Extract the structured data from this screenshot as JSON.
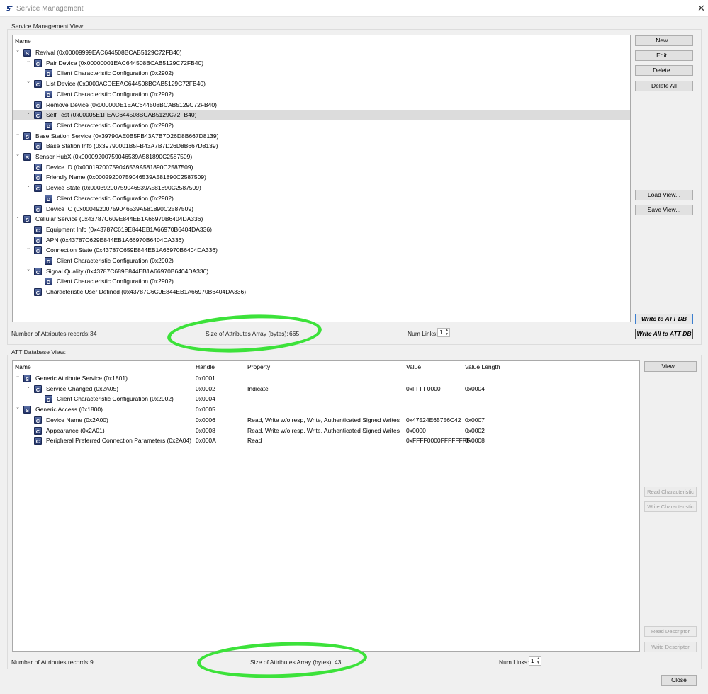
{
  "window": {
    "title": "Service Management"
  },
  "smv": {
    "label": "Service Management View:",
    "header": "Name",
    "items": [
      {
        "level": 0,
        "type": "S",
        "caret": "v",
        "label": "Revival (0x00009999EAC644508BCAB5129C72FB40)"
      },
      {
        "level": 1,
        "type": "C",
        "caret": "v",
        "label": "Pair Device (0x00000001EAC644508BCAB5129C72FB40)"
      },
      {
        "level": 2,
        "type": "D",
        "caret": "",
        "label": "Client Characteristic Configuration (0x2902)"
      },
      {
        "level": 1,
        "type": "C",
        "caret": "v",
        "label": "List Device (0x0000ACDEEAC644508BCAB5129C72FB40)"
      },
      {
        "level": 2,
        "type": "D",
        "caret": "",
        "label": "Client Characteristic Configuration (0x2902)"
      },
      {
        "level": 1,
        "type": "C",
        "caret": "",
        "label": "Remove Device (0x00000DE1EAC644508BCAB5129C72FB40)"
      },
      {
        "level": 1,
        "type": "C",
        "caret": "v",
        "label": "Self Test (0x00005E1FEAC644508BCAB5129C72FB40)",
        "selected": true
      },
      {
        "level": 2,
        "type": "D",
        "caret": "",
        "label": "Client Characteristic Configuration (0x2902)"
      },
      {
        "level": 0,
        "type": "S",
        "caret": "v",
        "label": "Base Station Service (0x39790AE0B5FB43A7B7D26D8B667D8139)"
      },
      {
        "level": 1,
        "type": "C",
        "caret": "",
        "label": "Base Station Info (0x39790001B5FB43A7B7D26D8B667D8139)"
      },
      {
        "level": 0,
        "type": "S",
        "caret": "v",
        "label": "Sensor HubX (0x00009200759046539A581890C2587509)"
      },
      {
        "level": 1,
        "type": "C",
        "caret": "",
        "label": "Device ID (0x00019200759046539A581890C2587509)"
      },
      {
        "level": 1,
        "type": "C",
        "caret": "",
        "label": "Friendly Name (0x00029200759046539A581890C2587509)"
      },
      {
        "level": 1,
        "type": "C",
        "caret": "v",
        "label": "Device State (0x00039200759046539A581890C2587509)"
      },
      {
        "level": 2,
        "type": "D",
        "caret": "",
        "label": "Client Characteristic Configuration (0x2902)"
      },
      {
        "level": 1,
        "type": "C",
        "caret": "",
        "label": "Device IO (0x00049200759046539A581890C2587509)"
      },
      {
        "level": 0,
        "type": "S",
        "caret": "v",
        "label": "Cellular Service (0x43787C609E844EB1A66970B6404DA336)"
      },
      {
        "level": 1,
        "type": "C",
        "caret": "",
        "label": "Equipment Info (0x43787C619E844EB1A66970B6404DA336)"
      },
      {
        "level": 1,
        "type": "C",
        "caret": "",
        "label": "APN  (0x43787C629E844EB1A66970B6404DA336)"
      },
      {
        "level": 1,
        "type": "C",
        "caret": "v",
        "label": "Connection State (0x43787C659E844EB1A66970B6404DA336)"
      },
      {
        "level": 2,
        "type": "D",
        "caret": "",
        "label": "Client Characteristic Configuration (0x2902)"
      },
      {
        "level": 1,
        "type": "C",
        "caret": "v",
        "label": "Signal Quality (0x43787C689E844EB1A66970B6404DA336)"
      },
      {
        "level": 2,
        "type": "D",
        "caret": "",
        "label": "Client Characteristic Configuration (0x2902)"
      },
      {
        "level": 1,
        "type": "C",
        "caret": "",
        "label": "Characteristic User Defined (0x43787C6C9E844EB1A66970B6404DA336)"
      }
    ],
    "buttons": {
      "new": "New...",
      "edit": "Edit...",
      "delete": "Delete...",
      "delete_all": "Delete All",
      "load_view": "Load View...",
      "save_view": "Save View...",
      "write_att": "Write to ATT DB",
      "write_all_att": "Write All to ATT DB"
    },
    "status": {
      "records_label": "Number of Attributes records:",
      "records_value": "34",
      "size_label": "Size of Attributes Array (bytes):",
      "size_value": "665",
      "links_label": "Num Links:",
      "links_value": "1"
    }
  },
  "att": {
    "label": "ATT Database View:",
    "columns": [
      "Name",
      "Handle",
      "Property",
      "Value",
      "Value Length"
    ],
    "rows": [
      {
        "level": 0,
        "type": "S",
        "caret": "v",
        "name": "Generic Attribute Service (0x1801)",
        "handle": "0x0001",
        "property": "",
        "value": "",
        "length": ""
      },
      {
        "level": 1,
        "type": "C",
        "caret": "v",
        "name": "Service Changed (0x2A05)",
        "handle": "0x0002",
        "property": "Indicate",
        "value": "0xFFFF0000",
        "length": "0x0004"
      },
      {
        "level": 2,
        "type": "D",
        "caret": "",
        "name": "Client Characteristic Configuration (0x2902)",
        "handle": "0x0004",
        "property": "",
        "value": "",
        "length": ""
      },
      {
        "level": 0,
        "type": "S",
        "caret": "v",
        "name": "Generic Access (0x1800)",
        "handle": "0x0005",
        "property": "",
        "value": "",
        "length": ""
      },
      {
        "level": 1,
        "type": "C",
        "caret": "",
        "name": "Device Name (0x2A00)",
        "handle": "0x0006",
        "property": "Read, Write w/o resp, Write, Authenticated Signed Writes",
        "value": "0x47524E65756C42",
        "length": "0x0007"
      },
      {
        "level": 1,
        "type": "C",
        "caret": "",
        "name": "Appearance (0x2A01)",
        "handle": "0x0008",
        "property": "Read, Write w/o resp, Write, Authenticated Signed Writes",
        "value": "0x0000",
        "length": "0x0002"
      },
      {
        "level": 1,
        "type": "C",
        "caret": "",
        "name": "Peripheral Preferred Connection Parameters (0x2A04)",
        "handle": "0x000A",
        "property": "Read",
        "value": "0xFFFF0000FFFFFFFF",
        "length": "0x0008"
      }
    ],
    "buttons": {
      "view": "View...",
      "read_char": "Read Characteristic",
      "write_char": "Write Characteristic",
      "read_desc": "Read Descriptor",
      "write_desc": "Write Descriptor"
    },
    "status": {
      "records_label": "Number of Attributes records:",
      "records_value": "9",
      "size_label": "Size of Attributes Array (bytes):",
      "size_value": "43",
      "links_label": "Num Links:",
      "links_value": "1"
    }
  },
  "close_label": "Close",
  "colors": {
    "annotation": "#3ce23a",
    "badge": "#24356b",
    "selection": "#dcdcdc"
  }
}
